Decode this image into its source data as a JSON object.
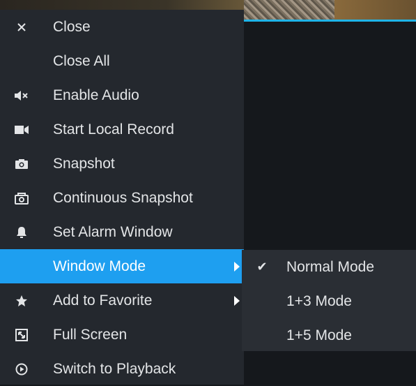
{
  "menu": {
    "items": [
      {
        "label": "Close",
        "icon": "close-icon",
        "has_submenu": false,
        "active": false
      },
      {
        "label": "Close All",
        "icon": null,
        "has_submenu": false,
        "active": false
      },
      {
        "label": "Enable Audio",
        "icon": "speaker-muted-icon",
        "has_submenu": false,
        "active": false
      },
      {
        "label": "Start Local Record",
        "icon": "video-camera-icon",
        "has_submenu": false,
        "active": false
      },
      {
        "label": "Snapshot",
        "icon": "camera-icon",
        "has_submenu": false,
        "active": false
      },
      {
        "label": "Continuous Snapshot",
        "icon": "burst-camera-icon",
        "has_submenu": false,
        "active": false
      },
      {
        "label": "Set Alarm Window",
        "icon": "bell-icon",
        "has_submenu": false,
        "active": false
      },
      {
        "label": "Window Mode",
        "icon": null,
        "has_submenu": true,
        "active": true
      },
      {
        "label": "Add to Favorite",
        "icon": "star-icon",
        "has_submenu": true,
        "active": false
      },
      {
        "label": "Full Screen",
        "icon": "fullscreen-icon",
        "has_submenu": false,
        "active": false
      },
      {
        "label": "Switch to Playback",
        "icon": "playback-icon",
        "has_submenu": false,
        "active": false
      }
    ]
  },
  "submenu": {
    "items": [
      {
        "label": "Normal Mode",
        "checked": true
      },
      {
        "label": "1+3 Mode",
        "checked": false
      },
      {
        "label": "1+5 Mode",
        "checked": false
      }
    ]
  },
  "colors": {
    "menu_bg": "#24282e",
    "active_bg": "#1e9ff0",
    "text": "#e3e5e7",
    "accent_line": "#1fb4e8"
  }
}
